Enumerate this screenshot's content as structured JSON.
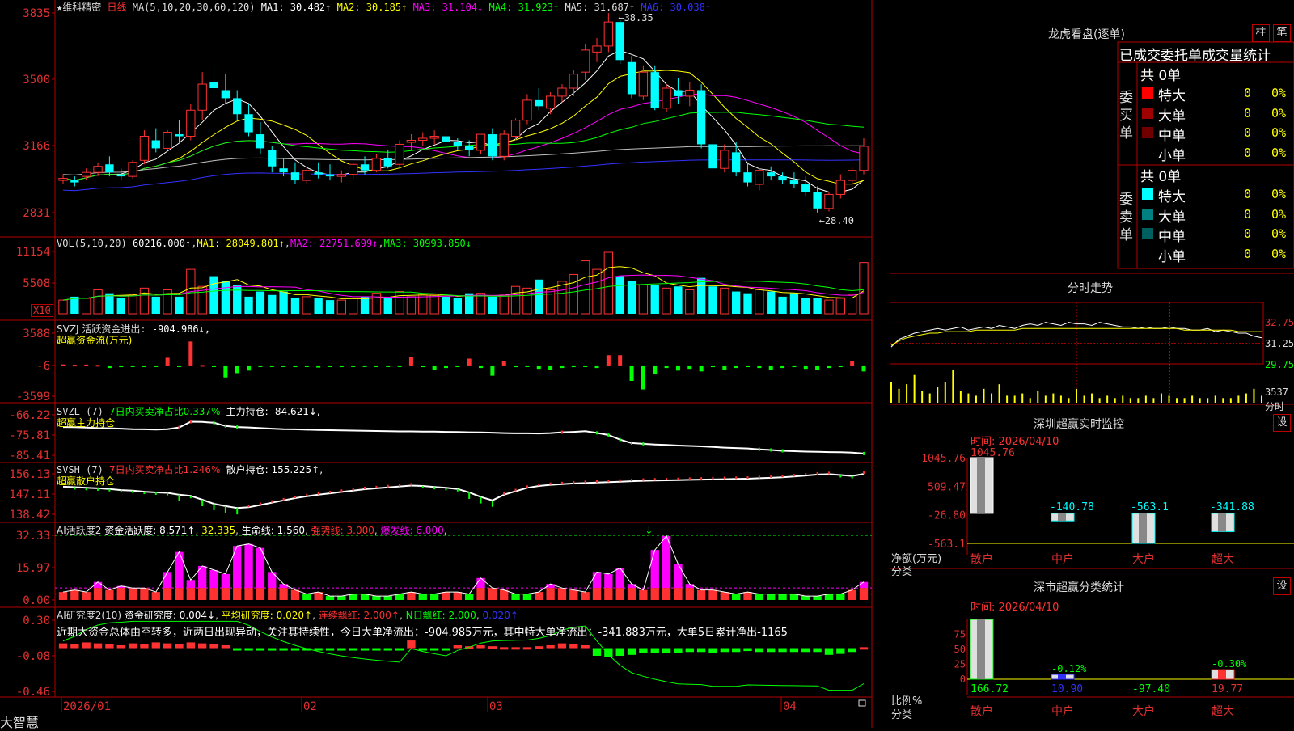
{
  "colors": {
    "up": "#ff3232",
    "down": "#00ffff",
    "border": "#b40000",
    "axis_text": "#e03030",
    "ma1": "#ffffff",
    "ma2": "#ffff00",
    "ma3": "#ff00ff",
    "ma4": "#00ff00",
    "ma5": "#c0c0c0",
    "ma6": "#3232ff",
    "green": "#00ff00",
    "magenta": "#ff00ff",
    "yellow": "#ffff00"
  },
  "header": {
    "star": "★",
    "stock": "维科精密",
    "period": "日线",
    "ma_params": "MA(5,10,20,30,60,120)",
    "ma1": "MA1: 30.482↑",
    "ma2": "MA2: 30.185↑",
    "ma3": "MA3: 31.104↓",
    "ma4": "MA4: 31.923↑",
    "ma5": "MA5: 31.687↑",
    "ma6": "MA6: 30.038↑"
  },
  "chart_data": [
    {
      "type": "candlestick",
      "title": "维科精密 日线",
      "ylim": [
        28.31,
        38.35
      ],
      "y_ticks": [
        "3835",
        "3500",
        "3166",
        "2831"
      ],
      "annotations": [
        "38.35",
        "28.40"
      ],
      "x_ticks": [
        "2026/01",
        "02",
        "03",
        "04"
      ],
      "ohlc": [
        [
          30.0,
          30.3,
          29.8,
          30.1
        ],
        [
          30.0,
          30.2,
          29.7,
          29.9
        ],
        [
          30.2,
          30.6,
          30.0,
          30.4
        ],
        [
          30.4,
          30.9,
          30.2,
          30.7
        ],
        [
          30.8,
          31.2,
          30.2,
          30.4
        ],
        [
          30.3,
          30.6,
          30.0,
          30.2
        ],
        [
          30.2,
          31.0,
          30.1,
          30.9
        ],
        [
          31.0,
          32.5,
          30.8,
          32.2
        ],
        [
          32.0,
          32.6,
          31.4,
          31.6
        ],
        [
          31.6,
          32.5,
          31.5,
          32.4
        ],
        [
          32.3,
          33.0,
          31.9,
          32.2
        ],
        [
          32.2,
          33.8,
          32.0,
          33.5
        ],
        [
          33.5,
          35.4,
          33.0,
          34.8
        ],
        [
          34.9,
          35.8,
          34.0,
          34.6
        ],
        [
          34.5,
          35.3,
          33.8,
          34.1
        ],
        [
          34.1,
          34.5,
          33.0,
          33.3
        ],
        [
          33.3,
          33.8,
          32.2,
          32.4
        ],
        [
          32.3,
          32.9,
          31.3,
          31.6
        ],
        [
          31.5,
          31.7,
          30.4,
          30.7
        ],
        [
          30.6,
          31.1,
          30.2,
          30.4
        ],
        [
          30.4,
          30.9,
          29.8,
          30.0
        ],
        [
          30.0,
          30.6,
          29.8,
          30.5
        ],
        [
          30.4,
          30.9,
          30.1,
          30.3
        ],
        [
          30.3,
          30.8,
          30.0,
          30.2
        ],
        [
          30.2,
          30.5,
          29.9,
          30.3
        ],
        [
          30.3,
          30.9,
          30.1,
          30.8
        ],
        [
          30.8,
          31.2,
          30.3,
          30.5
        ],
        [
          30.5,
          31.3,
          30.4,
          31.1
        ],
        [
          31.1,
          31.5,
          30.6,
          30.7
        ],
        [
          30.8,
          32.0,
          30.7,
          31.8
        ],
        [
          31.9,
          32.3,
          31.5,
          32.0
        ],
        [
          32.0,
          32.4,
          31.7,
          32.1
        ],
        [
          32.1,
          32.5,
          31.8,
          32.2
        ],
        [
          32.2,
          32.6,
          31.7,
          31.9
        ],
        [
          31.9,
          32.1,
          31.5,
          31.7
        ],
        [
          31.7,
          32.0,
          31.2,
          31.5
        ],
        [
          31.5,
          32.3,
          31.3,
          32.3
        ],
        [
          32.3,
          32.6,
          31.0,
          31.2
        ],
        [
          31.2,
          32.5,
          31.0,
          32.3
        ],
        [
          32.2,
          33.1,
          32.0,
          33.0
        ],
        [
          33.0,
          34.3,
          32.8,
          34.0
        ],
        [
          34.0,
          34.6,
          33.5,
          33.7
        ],
        [
          33.6,
          34.4,
          33.3,
          34.2
        ],
        [
          34.2,
          34.8,
          33.9,
          34.6
        ],
        [
          34.6,
          35.5,
          34.2,
          35.3
        ],
        [
          35.4,
          36.8,
          35.0,
          36.5
        ],
        [
          36.4,
          37.1,
          35.9,
          36.7
        ],
        [
          36.7,
          38.35,
          36.4,
          37.9
        ],
        [
          37.9,
          38.0,
          35.8,
          36.0
        ],
        [
          35.9,
          36.2,
          34.1,
          34.3
        ],
        [
          34.2,
          35.7,
          34.0,
          35.4
        ],
        [
          35.4,
          35.7,
          33.5,
          33.6
        ],
        [
          33.6,
          34.8,
          33.4,
          34.6
        ],
        [
          34.5,
          35.1,
          33.8,
          34.2
        ],
        [
          34.2,
          34.9,
          33.7,
          34.5
        ],
        [
          34.5,
          34.8,
          31.6,
          31.8
        ],
        [
          31.8,
          32.3,
          30.4,
          30.6
        ],
        [
          30.6,
          31.8,
          30.4,
          31.5
        ],
        [
          31.4,
          31.9,
          30.2,
          30.4
        ],
        [
          30.4,
          30.9,
          29.7,
          29.9
        ],
        [
          29.8,
          30.6,
          29.5,
          30.5
        ],
        [
          30.4,
          30.7,
          30.0,
          30.2
        ],
        [
          30.2,
          30.4,
          29.8,
          30.0
        ],
        [
          30.0,
          30.4,
          29.6,
          29.8
        ],
        [
          29.8,
          30.2,
          29.2,
          29.4
        ],
        [
          29.4,
          29.7,
          28.4,
          28.6
        ],
        [
          28.6,
          29.4,
          28.45,
          29.3
        ],
        [
          29.3,
          30.3,
          29.1,
          30.0
        ],
        [
          30.0,
          30.7,
          29.7,
          30.5
        ],
        [
          30.5,
          32.1,
          30.3,
          31.7
        ]
      ]
    },
    {
      "type": "bar",
      "title": "VOL(5,10,20)",
      "header_values": [
        "60216.000↑",
        "MA1: 28049.801↑",
        "MA2: 22751.699↑",
        "MA3: 30993.850↓"
      ],
      "y_ticks": [
        "11154",
        "5508"
      ],
      "unit_label": "X10",
      "values": [
        8,
        10,
        9,
        14,
        12,
        9,
        11,
        15,
        10,
        14,
        10,
        26,
        16,
        22,
        19,
        17,
        10,
        13,
        11,
        13,
        9,
        10,
        9,
        8,
        8,
        9,
        10,
        12,
        9,
        13,
        10,
        11,
        11,
        10,
        9,
        12,
        12,
        10,
        11,
        16,
        15,
        20,
        14,
        19,
        23,
        31,
        26,
        36,
        22,
        19,
        17,
        17,
        15,
        16,
        14,
        21,
        16,
        15,
        13,
        12,
        14,
        13,
        10,
        12,
        9,
        9,
        8,
        9,
        11,
        30
      ]
    },
    {
      "type": "bar",
      "title": "SVZJ 活跃资金进出",
      "header_value": "-904.986↓,",
      "subtitle": "超赢资金流(万元)",
      "y_ticks": [
        "3588",
        "-6",
        "-3599"
      ],
      "ylim": [
        -3599,
        3588
      ],
      "values": [
        120,
        80,
        100,
        60,
        -300,
        -200,
        -100,
        -150,
        -80,
        900,
        -100,
        2800,
        50,
        -100,
        -1400,
        -900,
        -600,
        -100,
        -150,
        -150,
        -200,
        -100,
        -250,
        -150,
        -200,
        -100,
        -50,
        -150,
        -100,
        -100,
        1000,
        -200,
        -500,
        -300,
        -200,
        800,
        -300,
        -1200,
        500,
        -200,
        -150,
        -400,
        -500,
        -300,
        -200,
        -100,
        -300,
        1200,
        1200,
        -1800,
        -2800,
        -1000,
        -300,
        -600,
        -400,
        -700,
        -200,
        -500,
        -300,
        -200,
        -300,
        -500,
        -300,
        -200,
        -400,
        -500,
        -300,
        -200,
        500,
        -700
      ]
    },
    {
      "type": "line",
      "title": "SVZL (7)",
      "header_values": [
        "7日内买卖净占比0.337%",
        "主力持仓: -84.621↓,"
      ],
      "subtitle": "超赢主力持仓",
      "y_ticks": [
        "-66.22",
        "-75.81",
        "-85.41"
      ],
      "ylim": [
        -85.41,
        -66.22
      ],
      "values": [
        -72.0,
        -72.1,
        -72.3,
        -72.5,
        -72.6,
        -72.8,
        -73.0,
        -73.1,
        -73.2,
        -73.0,
        -72.2,
        -69.5,
        -69.6,
        -70.0,
        -71.5,
        -72.0,
        -72.2,
        -72.5,
        -72.8,
        -73.0,
        -73.1,
        -73.3,
        -73.4,
        -73.5,
        -73.6,
        -73.7,
        -73.8,
        -73.9,
        -74.0,
        -74.1,
        -74.1,
        -74.2,
        -74.2,
        -74.3,
        -74.4,
        -74.5,
        -74.6,
        -74.7,
        -74.9,
        -75.0,
        -75.0,
        -75.1,
        -74.9,
        -74.5,
        -74.3,
        -74.0,
        -74.8,
        -75.8,
        -78.0,
        -79.6,
        -80.0,
        -80.3,
        -80.5,
        -80.8,
        -81.0,
        -81.2,
        -81.5,
        -81.8,
        -82.0,
        -82.2,
        -82.6,
        -82.9,
        -83.3,
        -83.5,
        -83.7,
        -83.8,
        -83.9,
        -84.0,
        -84.2,
        -84.6
      ]
    },
    {
      "type": "line",
      "title": "SVSH (7)",
      "header_values": [
        "7日内买卖净占比1.246%",
        "散户持仓: 155.225↑,"
      ],
      "subtitle": "超赢散户持仓",
      "y_ticks": [
        "156.13",
        "147.11",
        "138.42"
      ],
      "ylim": [
        138.42,
        156.13
      ],
      "values": [
        150.5,
        150.3,
        150.0,
        149.8,
        149.5,
        149.0,
        148.8,
        148.3,
        148.0,
        147.8,
        147.0,
        146.5,
        144.8,
        143.0,
        142.0,
        141.2,
        141.5,
        142.5,
        143.5,
        144.5,
        145.5,
        146.3,
        147.0,
        147.6,
        148.2,
        148.8,
        149.4,
        149.8,
        150.2,
        150.6,
        151.0,
        150.8,
        150.4,
        150.0,
        149.5,
        148.0,
        146.0,
        144.5,
        147.0,
        148.5,
        150.0,
        150.8,
        151.3,
        151.6,
        151.9,
        152.1,
        152.3,
        152.5,
        152.7,
        152.9,
        153.1,
        153.2,
        153.3,
        153.4,
        153.5,
        153.6,
        153.7,
        153.8,
        153.9,
        154.0,
        154.2,
        154.4,
        154.6,
        155.0,
        155.4,
        155.8,
        156.0,
        155.6,
        155.2,
        156.1
      ]
    },
    {
      "type": "bar",
      "title": "AI活跃度2",
      "header_values": [
        "资金活跃度: 8.571↑",
        "32.335",
        "生命线: 1.560",
        "强势线: 3.000",
        "爆发线: 6.000"
      ],
      "y_ticks": [
        "32.33",
        "15.97",
        "0.00"
      ],
      "ylim": [
        0,
        32.33
      ],
      "values": [
        4,
        5,
        4,
        9,
        5,
        7,
        6,
        6,
        4,
        14,
        24,
        10,
        17,
        15,
        13,
        27,
        28,
        26,
        14,
        8,
        5,
        3,
        4,
        2,
        2,
        3,
        3,
        2,
        2,
        3,
        4,
        3,
        3,
        4,
        4,
        3,
        11,
        6,
        5,
        3,
        3,
        4,
        8,
        6,
        5,
        4,
        14,
        13,
        16,
        8,
        5,
        25,
        32,
        18,
        8,
        5,
        5,
        4,
        3,
        4,
        3,
        3,
        3,
        3,
        2,
        2,
        3,
        3,
        5,
        9
      ]
    },
    {
      "type": "bar",
      "title": "AI研究度2(10)",
      "header_values": [
        "资金研究度: 0.004↓",
        "平均研究度: 0.020↑",
        "连续飘红: 2.000↑",
        "N日飘红: 2.000",
        "0.020↑"
      ],
      "y_ticks": [
        "0.30",
        "-0.08",
        "-0.46"
      ],
      "ylim": [
        -0.46,
        0.3
      ],
      "values": [
        0.05,
        0.04,
        0.06,
        0.05,
        0.04,
        0.03,
        0.05,
        0.04,
        0.06,
        0.05,
        0.04,
        0.06,
        0.05,
        0.04,
        0.03,
        -0.02,
        -0.02,
        -0.02,
        -0.02,
        -0.02,
        -0.02,
        -0.02,
        -0.02,
        -0.02,
        -0.02,
        -0.02,
        -0.02,
        -0.02,
        -0.02,
        -0.02,
        0.08,
        -0.02,
        -0.02,
        -0.02,
        0.03,
        0.02,
        0.03,
        0.02,
        0.01,
        0.01,
        0.01,
        0.02,
        0.03,
        0.05,
        0.04,
        0.03,
        -0.08,
        -0.09,
        -0.08,
        -0.07,
        -0.05,
        -0.05,
        -0.05,
        -0.05,
        -0.04,
        -0.04,
        -0.05,
        -0.04,
        -0.04,
        -0.03,
        -0.04,
        -0.04,
        -0.04,
        -0.04,
        -0.04,
        -0.04,
        -0.07,
        -0.06,
        -0.04,
        0.01
      ]
    }
  ],
  "ai_comment": "近期大资金总体由空转多，近两日出现异动，关注其持续性，今日大单净流出：-904.985万元，其中特大单净流出：-341.883万元，大单5日累计净出-1165",
  "footer": {
    "brand": "大智慧",
    "dates": [
      "2026/01",
      "02",
      "03",
      "04"
    ]
  },
  "right_panel": {
    "dragon_title": "龙虎看盘(逐单)",
    "btn_column": "柱",
    "btn_pen": "笔",
    "stat_header": "已成交委托单成交量统计",
    "buy_side_label": "委买单",
    "sell_side_label": "委卖单",
    "buy_total": "共 0单",
    "sell_total": "共 0单",
    "buy_rows": [
      {
        "label": "特大",
        "count": "0",
        "pct": "0%",
        "color": "#ff0000"
      },
      {
        "label": "大单",
        "count": "0",
        "pct": "0%",
        "color": "#a00000"
      },
      {
        "label": "中单",
        "count": "0",
        "pct": "0%",
        "color": "#700000"
      },
      {
        "label": "小单",
        "count": "0",
        "pct": "0%",
        "color": ""
      }
    ],
    "sell_rows": [
      {
        "label": "特大",
        "count": "0",
        "pct": "0%",
        "color": "#00ffff"
      },
      {
        "label": "大单",
        "count": "0",
        "pct": "0%",
        "color": "#008080"
      },
      {
        "label": "中单",
        "count": "0",
        "pct": "0%",
        "color": "#006060"
      },
      {
        "label": "小单",
        "count": "0",
        "pct": "0%",
        "color": ""
      }
    ],
    "intraday_title": "分时走势",
    "intraday_y_ticks": [
      "32.75",
      "31.25",
      "29.75",
      "3537"
    ],
    "intraday_unit": "分时",
    "intraday_price": [
      30.1,
      30.6,
      30.8,
      31.0,
      31.1,
      31.2,
      31.3,
      31.2,
      31.3,
      31.4,
      31.2,
      31.3,
      31.4,
      31.3,
      31.5,
      31.4,
      31.3,
      31.5,
      31.6,
      31.5,
      31.7,
      31.6,
      31.5,
      31.7,
      31.6,
      31.6,
      31.5,
      31.7,
      31.6,
      31.5,
      31.4,
      31.4,
      31.3,
      31.4,
      31.3,
      31.3,
      31.4,
      31.3,
      31.3,
      31.2,
      31.2,
      31.3,
      31.1,
      31.2,
      31.1,
      31.0,
      31.0,
      30.8,
      30.7
    ],
    "intraday_avg": [
      30.2,
      30.5,
      30.7,
      30.8,
      30.9,
      31.0,
      31.0,
      31.1,
      31.1,
      31.1,
      31.1,
      31.2,
      31.2,
      31.2,
      31.2,
      31.2,
      31.2,
      31.3,
      31.3,
      31.3,
      31.3,
      31.3,
      31.3,
      31.3,
      31.3,
      31.3,
      31.3,
      31.3,
      31.3,
      31.3,
      31.3,
      31.3,
      31.3,
      31.3,
      31.3,
      31.3,
      31.3,
      31.3,
      31.2,
      31.2,
      31.2,
      31.2,
      31.2,
      31.2,
      31.2,
      31.1,
      31.1,
      31.1,
      31.1
    ],
    "intraday_vol": [
      9,
      6,
      8,
      12,
      5,
      4,
      7,
      9,
      14,
      5,
      4,
      3,
      6,
      4,
      8,
      3,
      3,
      4,
      2,
      5,
      3,
      4,
      3,
      2,
      6,
      3,
      4,
      2,
      3,
      2,
      3,
      2,
      2,
      3,
      2,
      4,
      3,
      2,
      2,
      3,
      2,
      2,
      3,
      2,
      2,
      3,
      4,
      6,
      3
    ],
    "sz_monitor_title": "深圳超赢实时监控",
    "sz_time": "时间: 2026/04/10",
    "btn_set": "设",
    "sz_y_ticks": [
      "1045.76",
      "509.47",
      "-26.80",
      "-563.1"
    ],
    "sz_ylim": [
      -563.1,
      1045.76
    ],
    "sz_unit": "净额(万元)",
    "sz_axis": "分类",
    "sz_bars": [
      {
        "label": "散户",
        "value": 1045.76,
        "value_text": "1045.76"
      },
      {
        "label": "中户",
        "value": -140.78,
        "value_text": "-140.78"
      },
      {
        "label": "大户",
        "value": -563.1,
        "value_text": "-563.1"
      },
      {
        "label": "超大",
        "value": -341.88,
        "value_text": "-341.88"
      }
    ],
    "class_title": "深市超赢分类统计",
    "class_time": "时间: 2026/04/10",
    "class_y_ticks": [
      "75",
      "50",
      "25",
      "0"
    ],
    "class_unit": "比例%",
    "class_axis": "分类",
    "class_bars": [
      {
        "label": "散户",
        "value": 100,
        "pct_text": "",
        "amount": "166.72"
      },
      {
        "label": "中户",
        "value": 8,
        "pct_text": "-0.12%",
        "amount": "10.90"
      },
      {
        "label": "大户",
        "value": 0,
        "pct_text": "",
        "amount": "-97.40"
      },
      {
        "label": "超大",
        "value": 16,
        "pct_text": "-0.30%",
        "amount": "19.77"
      }
    ]
  }
}
